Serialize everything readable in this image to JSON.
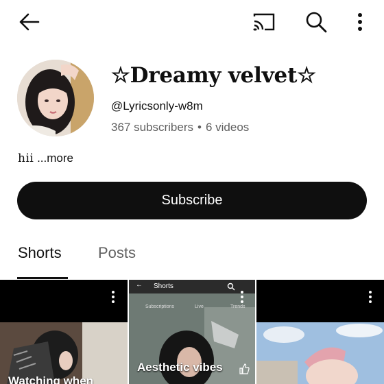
{
  "channel": {
    "name": "☆Dreamy velvet☆",
    "handle": "@Lyricsonly-w8m",
    "subscribers": "367 subscribers",
    "separator": "•",
    "videos": "6 videos",
    "description": "hii",
    "more_label": "...more"
  },
  "subscribe_label": "Subscribe",
  "tabs": [
    {
      "label": "Shorts",
      "selected": true
    },
    {
      "label": "Posts",
      "selected": false
    }
  ],
  "shorts": [
    {
      "caption": "Watching when"
    },
    {
      "caption": "Aesthetic vibes",
      "mini_title": "Shorts",
      "mini_tabs": [
        "Subscriptions",
        "Live",
        "Trends"
      ]
    },
    {
      "caption": ""
    }
  ],
  "colors": {
    "primary": "#0f0f0f",
    "secondary": "#606060",
    "background": "#ffffff"
  },
  "icons": [
    "back-arrow-icon",
    "cast-icon",
    "search-icon",
    "more-vert-icon"
  ]
}
